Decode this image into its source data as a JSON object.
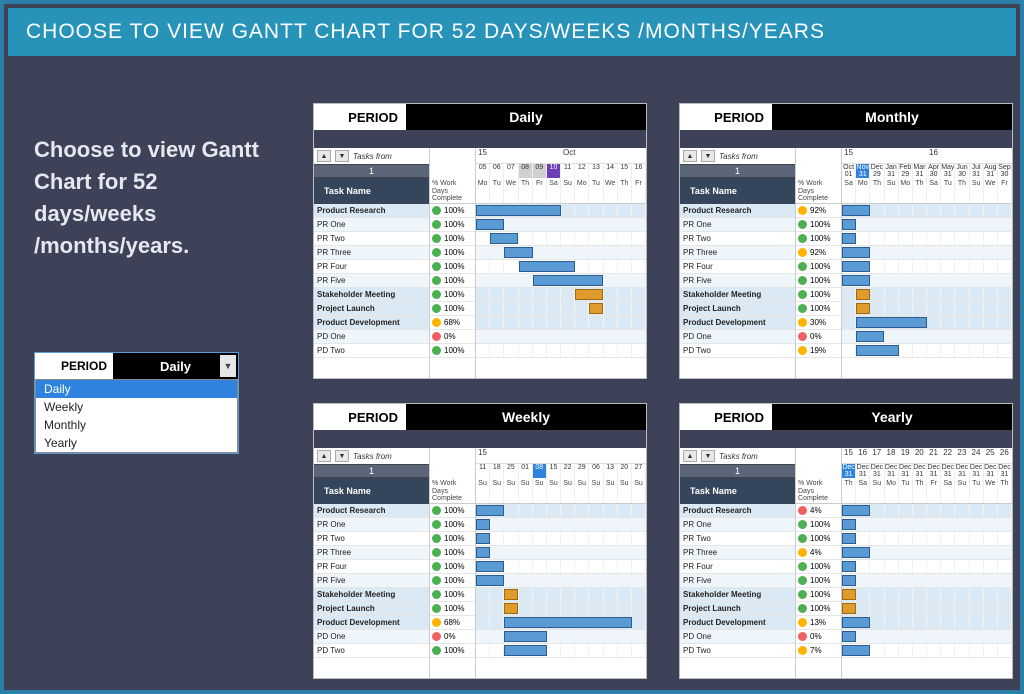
{
  "banner": "CHOOSE TO VIEW GANTT CHART FOR 52 DAYS/WEEKS /MONTHS/YEARS",
  "description": "Choose to view Gantt Chart for 52 days/weeks /months/years.",
  "dropdown": {
    "label": "PERIOD",
    "value": "Daily",
    "options": [
      "Daily",
      "Weekly",
      "Monthly",
      "Yearly"
    ],
    "selected": "Daily"
  },
  "common": {
    "tasks_from_label": "Tasks from",
    "row_num": "1",
    "task_name_header": "Task Name",
    "work_days_header": "% Work Days Complete"
  },
  "tasks_full": [
    {
      "name": "Product Research",
      "bold": true
    },
    {
      "name": "PR One"
    },
    {
      "name": "PR Two"
    },
    {
      "name": "PR Three"
    },
    {
      "name": "PR Four"
    },
    {
      "name": "PR Five"
    },
    {
      "name": "Stakeholder Meeting",
      "bold": true
    },
    {
      "name": "Project Launch",
      "bold": true
    },
    {
      "name": "Product Development",
      "bold": true
    },
    {
      "name": "PD One"
    },
    {
      "name": "PD Two"
    }
  ],
  "panels": {
    "daily": {
      "period_label": "PERIOD",
      "period_value": "Daily",
      "month_header": [
        "15",
        "Oct"
      ],
      "date_row": [
        "05",
        "06",
        "07",
        "08",
        "09",
        "10",
        "11",
        "12",
        "13",
        "14",
        "15",
        "16"
      ],
      "highlight_index": 5,
      "grey_indices": [
        3,
        4
      ],
      "dow": [
        "Mo",
        "Tu",
        "We",
        "Th",
        "Fr",
        "Sa",
        "Su",
        "Mo",
        "Tu",
        "We",
        "Th",
        "Fr"
      ],
      "pct": [
        {
          "c": "g",
          "v": "100%"
        },
        {
          "c": "g",
          "v": "100%"
        },
        {
          "c": "g",
          "v": "100%"
        },
        {
          "c": "g",
          "v": "100%"
        },
        {
          "c": "g",
          "v": "100%"
        },
        {
          "c": "g",
          "v": "100%"
        },
        {
          "c": "g",
          "v": "100%"
        },
        {
          "c": "g",
          "v": "100%"
        },
        {
          "c": "y",
          "v": "68%"
        },
        {
          "c": "r",
          "v": "0%"
        },
        {
          "c": "g",
          "v": "100%"
        }
      ],
      "bars": [
        {
          "row": 0,
          "start": 0,
          "len": 6,
          "color": "blue"
        },
        {
          "row": 1,
          "start": 0,
          "len": 2,
          "color": "blue"
        },
        {
          "row": 2,
          "start": 1,
          "len": 2,
          "color": "blue"
        },
        {
          "row": 3,
          "start": 2,
          "len": 2,
          "color": "blue"
        },
        {
          "row": 4,
          "start": 3,
          "len": 4,
          "color": "blue"
        },
        {
          "row": 5,
          "start": 4,
          "len": 5,
          "color": "blue"
        },
        {
          "row": 6,
          "start": 7,
          "len": 2,
          "color": "orange"
        },
        {
          "row": 7,
          "start": 8,
          "len": 1,
          "color": "orange"
        }
      ]
    },
    "monthly": {
      "period_label": "PERIOD",
      "period_value": "Monthly",
      "month_header": [
        "15",
        "16"
      ],
      "date_row": [
        "Oct",
        "Nov",
        "Dec",
        "Jan",
        "Feb",
        "Mar",
        "Apr",
        "May",
        "Jun",
        "Jul",
        "Aug",
        "Sep"
      ],
      "num_row": [
        "01",
        "31",
        "29",
        "31",
        "29",
        "31",
        "30",
        "31",
        "30",
        "31",
        "31",
        "30"
      ],
      "highlight_index": 1,
      "dow": [
        "Sa",
        "Mo",
        "Th",
        "Su",
        "Mo",
        "Th",
        "Sa",
        "Tu",
        "Th",
        "Su",
        "We",
        "Fr"
      ],
      "pct": [
        {
          "c": "y",
          "v": "92%"
        },
        {
          "c": "g",
          "v": "100%"
        },
        {
          "c": "g",
          "v": "100%"
        },
        {
          "c": "y",
          "v": "92%"
        },
        {
          "c": "g",
          "v": "100%"
        },
        {
          "c": "g",
          "v": "100%"
        },
        {
          "c": "g",
          "v": "100%"
        },
        {
          "c": "g",
          "v": "100%"
        },
        {
          "c": "y",
          "v": "30%"
        },
        {
          "c": "r",
          "v": "0%"
        },
        {
          "c": "y",
          "v": "19%"
        }
      ],
      "bars": [
        {
          "row": 0,
          "start": 0,
          "len": 2,
          "color": "blue"
        },
        {
          "row": 1,
          "start": 0,
          "len": 1,
          "color": "blue"
        },
        {
          "row": 2,
          "start": 0,
          "len": 1,
          "color": "blue"
        },
        {
          "row": 3,
          "start": 0,
          "len": 2,
          "color": "blue"
        },
        {
          "row": 4,
          "start": 0,
          "len": 2,
          "color": "blue"
        },
        {
          "row": 5,
          "start": 0,
          "len": 2,
          "color": "blue"
        },
        {
          "row": 6,
          "start": 1,
          "len": 1,
          "color": "orange"
        },
        {
          "row": 7,
          "start": 1,
          "len": 1,
          "color": "orange"
        },
        {
          "row": 8,
          "start": 1,
          "len": 5,
          "color": "blue"
        },
        {
          "row": 9,
          "start": 1,
          "len": 2,
          "color": "blue"
        },
        {
          "row": 10,
          "start": 1,
          "len": 3,
          "color": "blue"
        }
      ]
    },
    "weekly": {
      "period_label": "PERIOD",
      "period_value": "Weekly",
      "month_header": [
        "15"
      ],
      "date_row": [
        "11",
        "18",
        "25",
        "01",
        "08",
        "15",
        "22",
        "29",
        "06",
        "13",
        "20",
        "27"
      ],
      "highlight_index": 4,
      "dow": [
        "Su",
        "Su",
        "Su",
        "Su",
        "Su",
        "Su",
        "Su",
        "Su",
        "Su",
        "Su",
        "Su",
        "Su"
      ],
      "pct": [
        {
          "c": "g",
          "v": "100%"
        },
        {
          "c": "g",
          "v": "100%"
        },
        {
          "c": "g",
          "v": "100%"
        },
        {
          "c": "g",
          "v": "100%"
        },
        {
          "c": "g",
          "v": "100%"
        },
        {
          "c": "g",
          "v": "100%"
        },
        {
          "c": "g",
          "v": "100%"
        },
        {
          "c": "g",
          "v": "100%"
        },
        {
          "c": "y",
          "v": "68%"
        },
        {
          "c": "r",
          "v": "0%"
        },
        {
          "c": "g",
          "v": "100%"
        }
      ],
      "bars": [
        {
          "row": 0,
          "start": 0,
          "len": 2,
          "color": "blue"
        },
        {
          "row": 1,
          "start": 0,
          "len": 1,
          "color": "blue"
        },
        {
          "row": 2,
          "start": 0,
          "len": 1,
          "color": "blue"
        },
        {
          "row": 3,
          "start": 0,
          "len": 1,
          "color": "blue"
        },
        {
          "row": 4,
          "start": 0,
          "len": 2,
          "color": "blue"
        },
        {
          "row": 5,
          "start": 0,
          "len": 2,
          "color": "blue"
        },
        {
          "row": 6,
          "start": 2,
          "len": 1,
          "color": "orange"
        },
        {
          "row": 7,
          "start": 2,
          "len": 1,
          "color": "orange"
        },
        {
          "row": 8,
          "start": 2,
          "len": 9,
          "color": "blue"
        },
        {
          "row": 9,
          "start": 2,
          "len": 3,
          "color": "blue"
        },
        {
          "row": 10,
          "start": 2,
          "len": 3,
          "color": "blue"
        }
      ]
    },
    "yearly": {
      "period_label": "PERIOD",
      "period_value": "Yearly",
      "month_header": [
        "15",
        "16",
        "17",
        "18",
        "19",
        "20",
        "21",
        "22",
        "23",
        "24",
        "25",
        "26"
      ],
      "date_row": [
        "Dec",
        "Dec",
        "Dec",
        "Dec",
        "Dec",
        "Dec",
        "Dec",
        "Dec",
        "Dec",
        "Dec",
        "Dec",
        "Dec"
      ],
      "num_row": [
        "31",
        "31",
        "31",
        "31",
        "31",
        "31",
        "31",
        "31",
        "31",
        "31",
        "31",
        "31"
      ],
      "highlight_index": 0,
      "dow": [
        "Th",
        "Sa",
        "Su",
        "Mo",
        "Tu",
        "Th",
        "Fr",
        "Sa",
        "Su",
        "Tu",
        "We",
        "Th"
      ],
      "pct": [
        {
          "c": "r",
          "v": "4%"
        },
        {
          "c": "g",
          "v": "100%"
        },
        {
          "c": "g",
          "v": "100%"
        },
        {
          "c": "y",
          "v": "4%"
        },
        {
          "c": "g",
          "v": "100%"
        },
        {
          "c": "g",
          "v": "100%"
        },
        {
          "c": "g",
          "v": "100%"
        },
        {
          "c": "g",
          "v": "100%"
        },
        {
          "c": "y",
          "v": "13%"
        },
        {
          "c": "r",
          "v": "0%"
        },
        {
          "c": "y",
          "v": "7%"
        }
      ],
      "bars": [
        {
          "row": 0,
          "start": 0,
          "len": 2,
          "color": "blue"
        },
        {
          "row": 1,
          "start": 0,
          "len": 1,
          "color": "blue"
        },
        {
          "row": 2,
          "start": 0,
          "len": 1,
          "color": "blue"
        },
        {
          "row": 3,
          "start": 0,
          "len": 2,
          "color": "blue"
        },
        {
          "row": 4,
          "start": 0,
          "len": 1,
          "color": "blue"
        },
        {
          "row": 5,
          "start": 0,
          "len": 1,
          "color": "blue"
        },
        {
          "row": 6,
          "start": 0,
          "len": 1,
          "color": "orange"
        },
        {
          "row": 7,
          "start": 0,
          "len": 1,
          "color": "orange"
        },
        {
          "row": 8,
          "start": 0,
          "len": 2,
          "color": "blue"
        },
        {
          "row": 9,
          "start": 0,
          "len": 1,
          "color": "blue"
        },
        {
          "row": 10,
          "start": 0,
          "len": 2,
          "color": "blue"
        }
      ]
    }
  }
}
